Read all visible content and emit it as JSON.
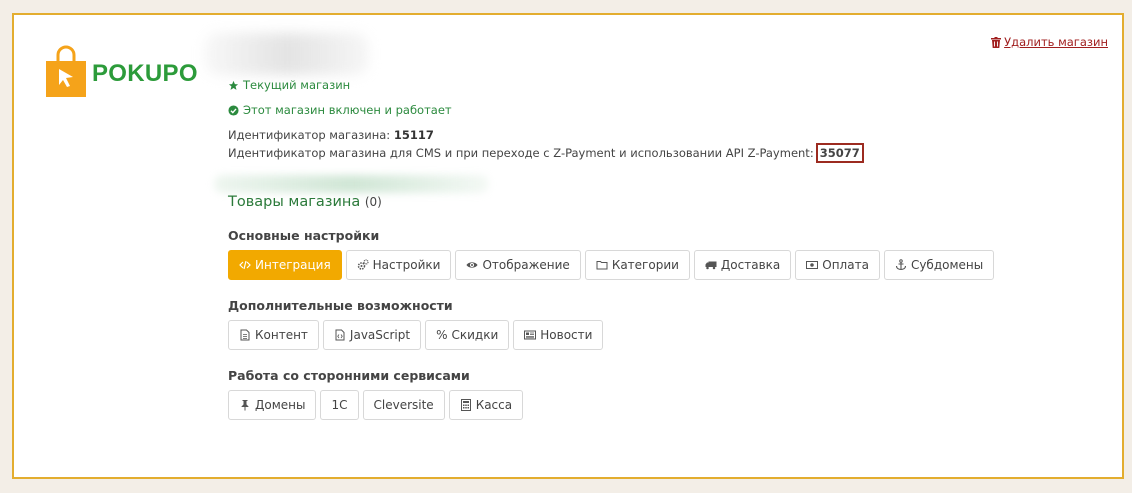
{
  "brand": {
    "name": "POKUPO",
    "color": "#2c9b3a",
    "bag_color": "#f5a31a"
  },
  "header": {
    "delete_label": "Удалить магазин"
  },
  "status": {
    "current": "Текущий магазин",
    "enabled": "Этот магазин включен и работает"
  },
  "ids": {
    "shop_label": "Идентификатор магазина:",
    "shop_value": "15117",
    "cms_label": "Идентификатор магазина для CMS и при переходе с Z-Payment и использовании API Z-Payment:",
    "cms_value": "35077"
  },
  "goods": {
    "title": "Товары магазина",
    "count": "(0)"
  },
  "sections": {
    "main": {
      "title": "Основные настройки",
      "buttons": [
        "Интеграция",
        "Настройки",
        "Отображение",
        "Категории",
        "Доставка",
        "Оплата",
        "Субдомены"
      ]
    },
    "extra": {
      "title": "Дополнительные возможности",
      "buttons": [
        "Контент",
        "JavaScript",
        "Скидки",
        "Новости"
      ]
    },
    "third": {
      "title": "Работа со сторонними сервисами",
      "buttons": [
        "Домены",
        "1С",
        "Cleversite",
        "Касса"
      ]
    }
  },
  "colors": {
    "accent": "#f2a900",
    "link_red": "#a11f1f",
    "status_green": "#2b8a3e",
    "frame": "#e3ad2f"
  }
}
